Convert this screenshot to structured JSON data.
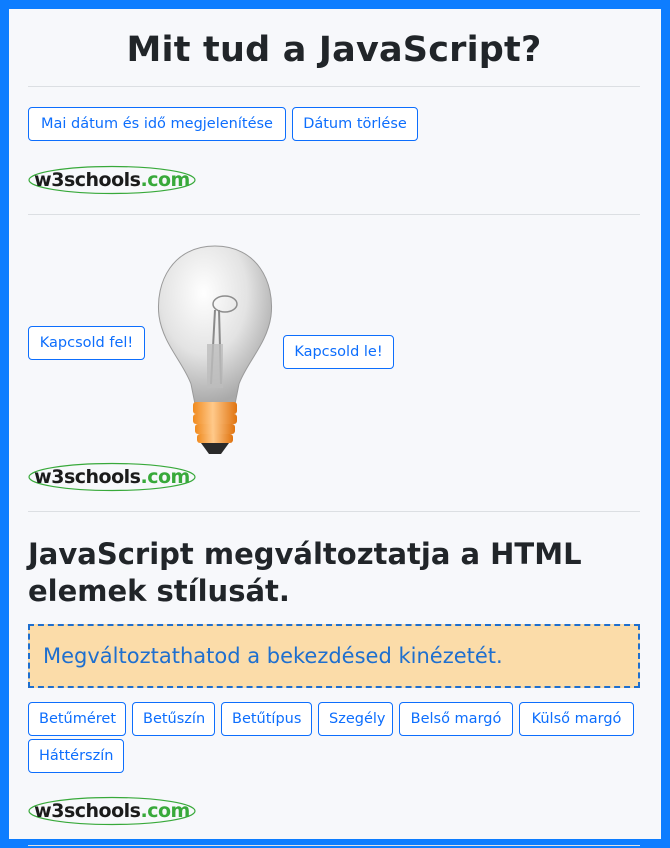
{
  "page": {
    "title": "Mit tud a JavaScript?"
  },
  "date_section": {
    "show_date_label": "Mai dátum és idő megjelenítése",
    "clear_date_label": "Dátum törlése",
    "logo": {
      "w3": "w3schools",
      "com": ".com"
    }
  },
  "bulb_section": {
    "on_label": "Kapcsold fel!",
    "off_label": "Kapcsold le!",
    "logo": {
      "w3": "w3schools",
      "com": ".com"
    }
  },
  "style_section": {
    "heading": "JavaScript megváltoztatja a HTML elemek stílusát.",
    "demo_text": "Megváltoztathatod a bekezdésed kinézetét.",
    "buttons": [
      "Betűméret",
      "Betűszín",
      "Betűtípus",
      "Szegély",
      "Belső margó",
      "Külső margó",
      "Háttérszín"
    ],
    "logo": {
      "w3": "w3schools",
      "com": ".com"
    }
  },
  "colors": {
    "frame_border": "#0d7dff",
    "button_blue": "#0d6efd",
    "demo_background": "#fbdca9",
    "demo_text": "#1e6fcf"
  }
}
